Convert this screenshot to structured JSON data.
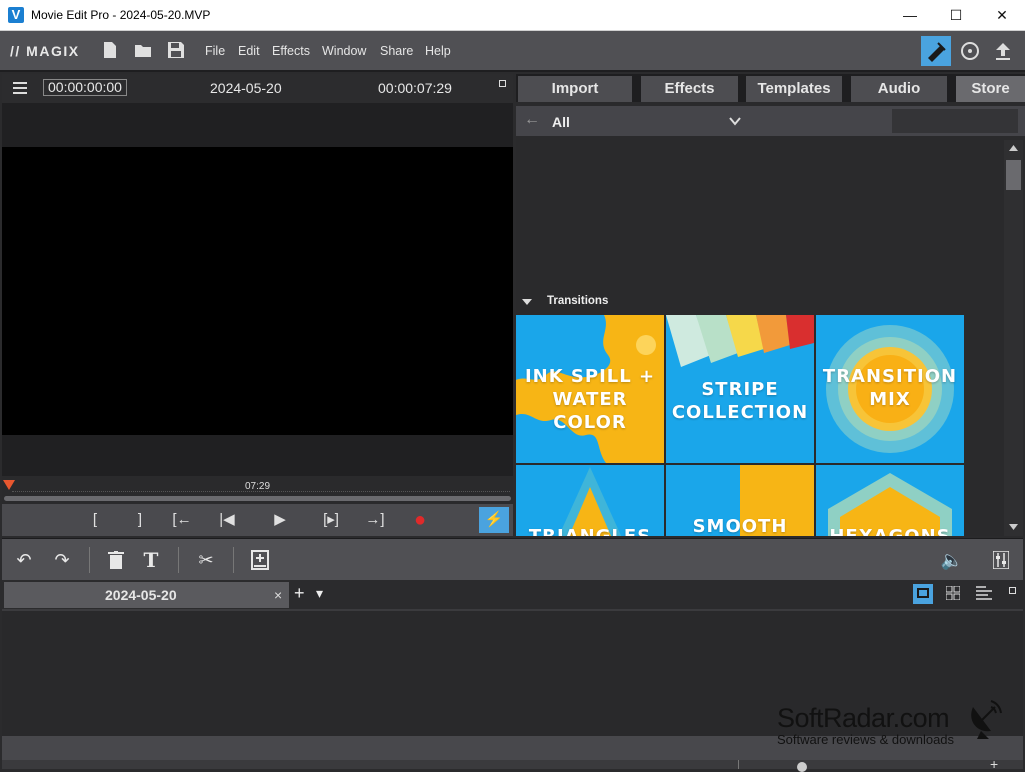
{
  "window": {
    "title": "Movie Edit Pro - 2024-05-20.MVP",
    "controls": {
      "minimize": "—",
      "maximize": "☐",
      "close": "✕"
    }
  },
  "menubar": {
    "logo": "// MAGIX",
    "items": [
      "File",
      "Edit",
      "Effects",
      "Window",
      "Share",
      "Help"
    ]
  },
  "preview": {
    "timecode_left": "00:00:00:00",
    "title": "2024-05-20",
    "timecode_right": "00:00:07:29",
    "scrub_time": "07:29",
    "transport": {
      "mark_in": "[",
      "mark_out": "]",
      "prev_marker": "[←",
      "prev_frame": "|◀",
      "play": "▶",
      "next_marker": "[▸]",
      "to_end": "→]",
      "record": "●",
      "fast": "⚡"
    }
  },
  "media": {
    "tabs": [
      "Import",
      "Effects",
      "Templates",
      "Audio",
      "Store"
    ],
    "active_tab": "Store",
    "filter": {
      "back": "←",
      "value": "All",
      "chevron": "⌄"
    },
    "section": "Transitions",
    "tiles": [
      {
        "line1": "INK SPILL +",
        "line2": "WATER COLOR"
      },
      {
        "line1": "STRIPE",
        "line2": "COLLECTION"
      },
      {
        "line1": "TRANSITION",
        "line2": "MIX"
      },
      {
        "line1": "TRIANGLES",
        "line2": ""
      },
      {
        "line1": "SMOOTH",
        "line2": ""
      },
      {
        "line1": "HEXAGONS",
        "line2": ""
      }
    ]
  },
  "timeline": {
    "tab_label": "2024-05-20",
    "tab_close": "×",
    "add": "+",
    "dropdown": "▾"
  },
  "watermark": {
    "title": "SoftRadar.com",
    "subtitle": "Software reviews & downloads"
  },
  "colors": {
    "accent": "#4aa3df",
    "record": "#e02a2a",
    "tile_yellow": "#f7b515",
    "tile_blue": "#1aa6ea"
  }
}
